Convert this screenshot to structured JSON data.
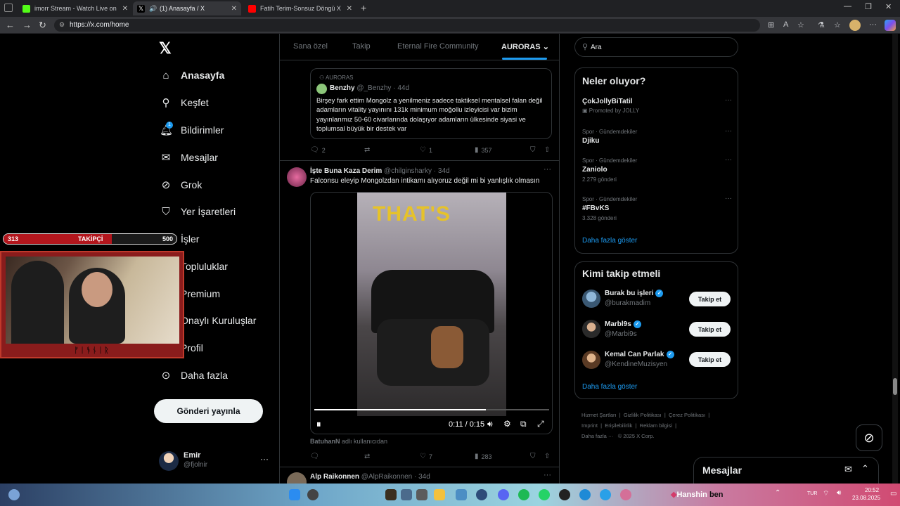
{
  "browser": {
    "tabs": [
      {
        "title": "imorr Stream - Watch Live on Kick",
        "active": false
      },
      {
        "title": "(1) Anasayfa / X",
        "active": true
      },
      {
        "title": "Fatih Terim-Sonsuz Döngü X Kafa",
        "active": false
      }
    ],
    "url": "https://x.com/home"
  },
  "sidebar": {
    "logo": "X",
    "items": [
      {
        "label": "Anasayfa",
        "icon": "home-icon"
      },
      {
        "label": "Keşfet",
        "icon": "search-icon"
      },
      {
        "label": "Bildirimler",
        "icon": "bell-icon",
        "badge": "1"
      },
      {
        "label": "Mesajlar",
        "icon": "mail-icon"
      },
      {
        "label": "Grok",
        "icon": "grok-icon"
      },
      {
        "label": "Yer İşaretleri",
        "icon": "bookmark-icon"
      },
      {
        "label": "İşler",
        "icon": "briefcase-icon"
      },
      {
        "label": "Topluluklar",
        "icon": "people-icon"
      },
      {
        "label": "Premium",
        "icon": "x-icon"
      },
      {
        "label": "Onaylı Kuruluşlar",
        "icon": "lightning-icon"
      },
      {
        "label": "Profil",
        "icon": "user-icon"
      },
      {
        "label": "Daha fazla",
        "icon": "more-circle-icon"
      }
    ],
    "post_button": "Gönderi yayınla",
    "account": {
      "name": "Emir",
      "handle": "@fjolnir"
    }
  },
  "stream_overlay": {
    "followers_count": "313",
    "followers_label": "TAKİPÇİ",
    "goal": "500",
    "streamer_tag": "ᚠᛁᚬᚾᛁᚱ"
  },
  "timeline": {
    "tabs": [
      "Sana özel",
      "Takip",
      "Eternal Fire Community",
      "AURORAS"
    ],
    "active_tab": "AURORAS",
    "quoted_tweet": {
      "community": "AURORAS",
      "author": "Benzhy",
      "handle": "@_Benzhy",
      "time": "44d",
      "text": "Birşey fark ettim Mongolz a yenilmeniz sadece taktiksel mentalsel falan değil adamların vitality yayınını 131k minimum moğollu izleyicisi var bizim yayınlarımız 50-60 civarlarında dolaşıyor adamların ülkesinde siyasi ve toplumsal büyük bir destek var"
    },
    "first_actions": {
      "replies": "2",
      "retweets": "",
      "likes": "1",
      "views": "357"
    },
    "tweet2": {
      "author": "İşte Buna Kaza Derim",
      "handle": "@chilginsharky",
      "time": "34d",
      "text": "Falconsu eleyip Mongolzdan intikamı alıyoruz değil mi bi yanlışlık olmasın",
      "video_caption": "THAT'S",
      "video_time": "0:11 / 0:15",
      "video_progress": 0.73,
      "footer_user": "BatuhanN",
      "footer_suffix": "adlı kullanıcıdan",
      "replies": "",
      "retweets": "",
      "likes": "7",
      "views": "283"
    },
    "tweet3": {
      "author": "Alp Raikonnen",
      "handle": "@AlpRaikonnen",
      "time": "34d"
    }
  },
  "right": {
    "search_placeholder": "Ara",
    "trends_title": "Neler oluyor?",
    "trends": [
      {
        "context": "",
        "name": "ÇokJollyBiTatil",
        "meta": "Promoted by JOLLY"
      },
      {
        "context": "Spor · Gündemdekiler",
        "name": "Djiku",
        "meta": ""
      },
      {
        "context": "Spor · Gündemdekiler",
        "name": "Zaniolo",
        "meta": "2.279 gönderi"
      },
      {
        "context": "Spor · Gündemdekiler",
        "name": "#FBvKS",
        "meta": "3.328 gönderi"
      }
    ],
    "trends_more": "Daha fazla göster",
    "who_title": "Kimi takip etmeli",
    "who": [
      {
        "name": "Burak bu işleri",
        "handle": "@burakmadim",
        "button": "Takip et"
      },
      {
        "name": "Marbl9s",
        "handle": "@Marbi9s",
        "button": "Takip et"
      },
      {
        "name": "Kemal Can Parlak",
        "handle": "@KendineMuzisyen",
        "button": "Takip et"
      }
    ],
    "who_more": "Daha fazla göster",
    "footer_links": [
      "Hizmet Şartları",
      "Gizlilik Politikası",
      "Çerez Politikası",
      "Imprint",
      "Erişilebilirlik",
      "Reklam bilgisi",
      "Daha fazla ···",
      "© 2025 X Corp."
    ],
    "messages_label": "Mesajlar"
  },
  "taskbar": {
    "lang": "TUR",
    "time": "20:52",
    "date": "23.08.2025",
    "overlay_name": "Hanshin",
    "overlay_text": "ben"
  },
  "colors": {
    "accent": "#1d9bf0",
    "stream_red": "#c0392b"
  }
}
